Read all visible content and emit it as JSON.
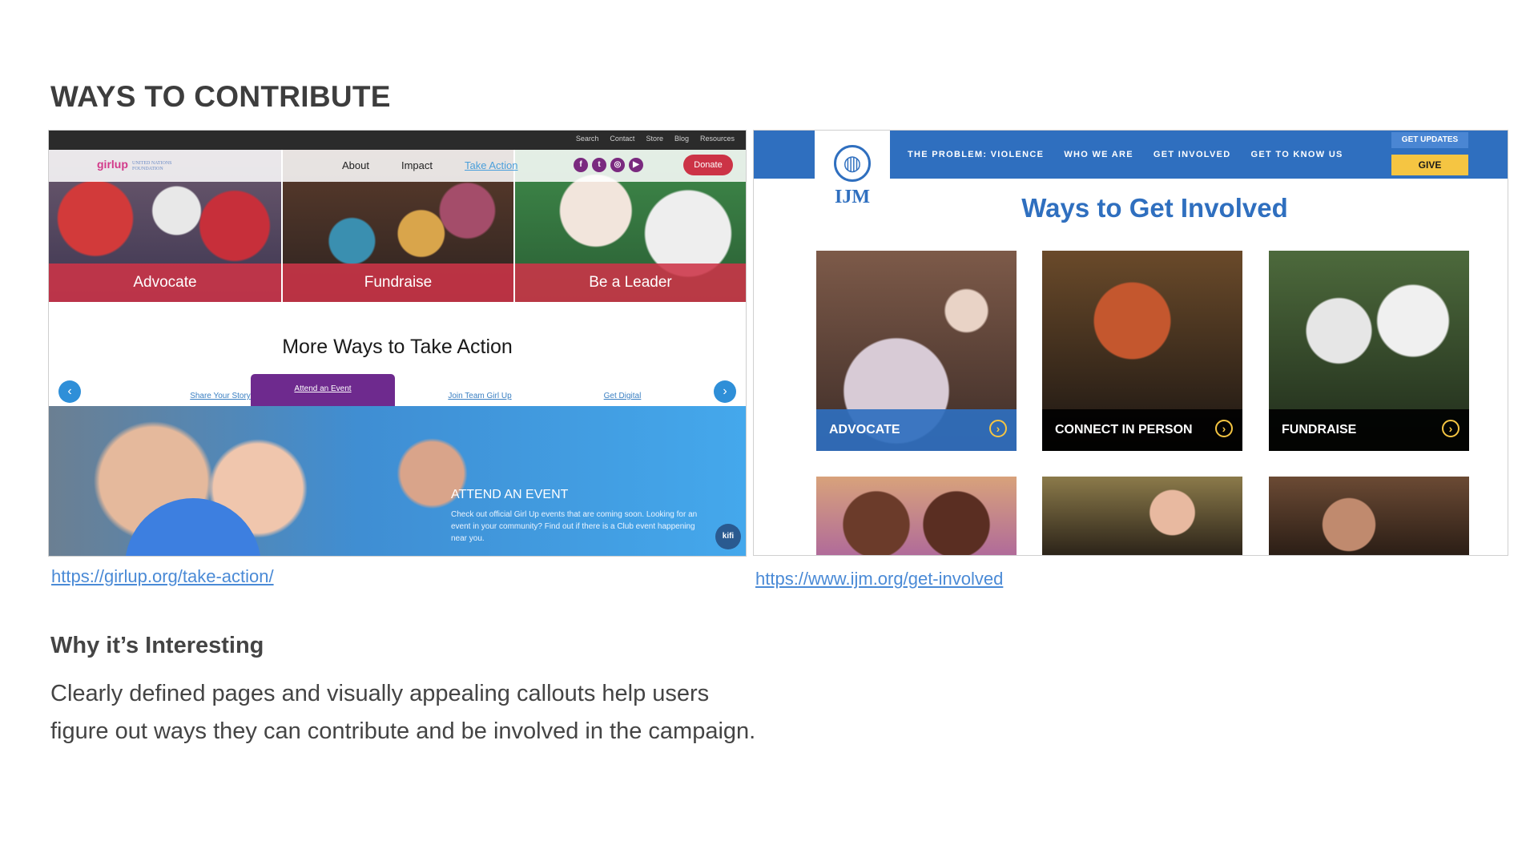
{
  "slide": {
    "title": "WAYS TO CONTRIBUTE",
    "why_title": "Why it’s Interesting",
    "why_body": "Clearly defined pages and visually appealing callouts help users figure out ways they can contribute and be involved in the campaign."
  },
  "girlup": {
    "url": "https://girlup.org/take-action/",
    "toplinks": [
      "Search",
      "Contact",
      "Store",
      "Blog",
      "Resources"
    ],
    "logo": "girlup",
    "logo_sub": "UNITED NATIONS FOUNDATION",
    "menu": [
      "About",
      "Impact",
      "Take Action"
    ],
    "social_icons": [
      "facebook-icon",
      "twitter-icon",
      "instagram-icon",
      "youtube-icon"
    ],
    "donate": "Donate",
    "tiles": [
      "Advocate",
      "Fundraise",
      "Be a Leader"
    ],
    "more_heading": "More Ways to Take Action",
    "tabs": [
      "Share Your Story",
      "Attend an Event",
      "Join Team Girl Up",
      "Get Digital"
    ],
    "event_title": "ATTEND AN EVENT",
    "event_desc": "Check out official Girl Up events that are coming soon. Looking for an event in your community? Find out if there is a Club event happening near you.",
    "kifi": "kifi",
    "colors": {
      "tile_band": "#cd3448",
      "tab_selected": "#6e2a8e",
      "accent_blue": "#2f8fd8"
    }
  },
  "ijm": {
    "url": "https://www.ijm.org/get-involved",
    "logo": "IJM",
    "menu": [
      "THE PROBLEM: VIOLENCE",
      "WHO WE ARE",
      "GET INVOLVED",
      "GET TO KNOW US"
    ],
    "updates": "GET UPDATES",
    "give": "GIVE",
    "heading": "Ways to Get Involved",
    "cards": [
      "ADVOCATE",
      "CONNECT IN PERSON",
      "FUNDRAISE"
    ],
    "colors": {
      "brand_blue": "#2f6fbf",
      "give_yellow": "#f5c542"
    }
  }
}
